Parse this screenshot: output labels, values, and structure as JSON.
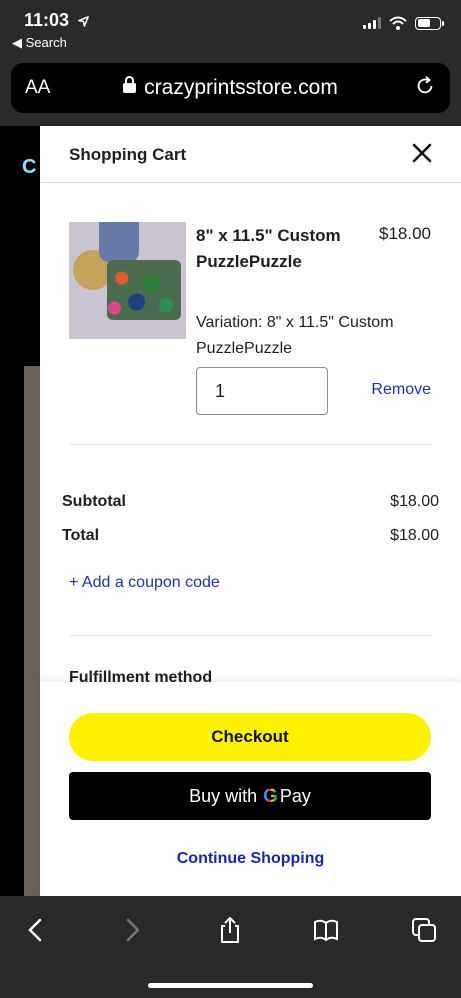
{
  "status_bar": {
    "time": "11:03",
    "back_label": "◀ Search"
  },
  "url_bar": {
    "text_size_label": "AA",
    "domain": "crazyprintsstore.com"
  },
  "background_page": {
    "visible_letter": "C"
  },
  "cart": {
    "title": "Shopping Cart",
    "item": {
      "name": "8\" x 11.5\" Custom PuzzlePuzzle",
      "price": "$18.00",
      "variation": "Variation: 8\" x 11.5\" Custom PuzzlePuzzle",
      "quantity": "1",
      "remove_label": "Remove"
    },
    "summary": {
      "subtotal_label": "Subtotal",
      "subtotal_value": "$18.00",
      "total_label": "Total",
      "total_value": "$18.00"
    },
    "coupon_label": "+ Add a coupon code",
    "fulfillment_label": "Fulfillment method",
    "checkout_label": "Checkout",
    "gpay_prefix": "Buy with",
    "gpay_g": "G",
    "gpay_suffix": "Pay",
    "continue_label": "Continue Shopping"
  },
  "colors": {
    "checkout_bg": "#fff200",
    "link_blue": "#2033a8",
    "chrome_bg": "#2a2a2a"
  }
}
